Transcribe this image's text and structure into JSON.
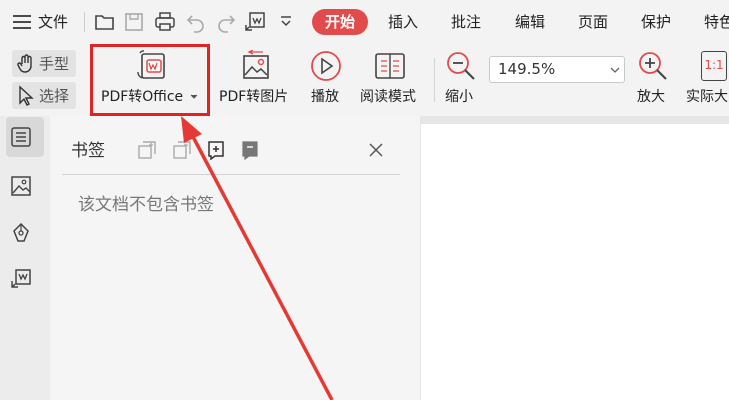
{
  "menu": {
    "file_label": "文件",
    "tabs": [
      "开始",
      "插入",
      "批注",
      "编辑",
      "页面",
      "保护",
      "特色"
    ]
  },
  "ribbon": {
    "hand_tool_label": "手型",
    "select_tool_label": "选择",
    "pdf_to_office_label": "PDF转Office",
    "pdf_to_image_label": "PDF转图片",
    "play_label": "播放",
    "read_mode_label": "阅读模式",
    "zoom_out_label": "缩小",
    "zoom_value": "149.5%",
    "zoom_in_label": "放大",
    "actual_size_label": "实际大",
    "actual_size_icon_text": "1:1"
  },
  "panel": {
    "title": "书签",
    "empty_message": "该文档不包含书签"
  },
  "colors": {
    "accent": "#e14b4b",
    "highlight_border": "#e02424",
    "annotation_arrow": "#e53935"
  }
}
